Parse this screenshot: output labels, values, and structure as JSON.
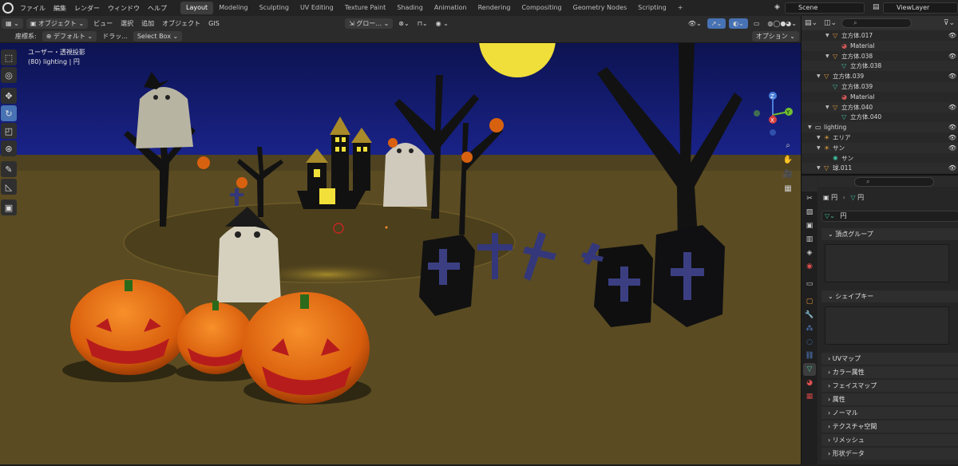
{
  "menus": [
    "ファイル",
    "編集",
    "レンダー",
    "ウィンドウ",
    "ヘルプ"
  ],
  "workspaces": [
    "Layout",
    "Modeling",
    "Sculpting",
    "UV Editing",
    "Texture Paint",
    "Shading",
    "Animation",
    "Rendering",
    "Compositing",
    "Geometry Nodes",
    "Scripting",
    "+"
  ],
  "scene": {
    "label": "Scene",
    "view_layer": "ViewLayer"
  },
  "header1": {
    "mode": "オブジェクト",
    "view": "ビュー",
    "select": "選択",
    "add": "追加",
    "object": "オブジェクト",
    "gis": "GIS",
    "transform": "グロー..."
  },
  "header2": {
    "coord_label": "座標系:",
    "coord_value": "デフォルト",
    "drag_label": "ドラッ...",
    "drag_value": "Select Box",
    "options": "オプション"
  },
  "viewport": {
    "view_name": "ユーザー・透視投影",
    "object_info": "(80) lighting | 円"
  },
  "gizmo": {
    "x": "X",
    "y": "Y",
    "z": "Z"
  },
  "outliner": {
    "rows": [
      {
        "label": "立方体.017",
        "indent": 3,
        "icon": "mesh",
        "color": "#e09a3c"
      },
      {
        "label": "Material",
        "indent": 4,
        "icon": "material",
        "color": "#c55"
      },
      {
        "label": "立方体.038",
        "indent": 3,
        "icon": "mesh",
        "color": "#e09a3c"
      },
      {
        "label": "立方体.038",
        "indent": 4,
        "icon": "meshdata",
        "color": "#3fbf9f"
      },
      {
        "label": "立方体.039",
        "indent": 2,
        "icon": "mesh",
        "color": "#e09a3c"
      },
      {
        "label": "立方体.039",
        "indent": 3,
        "icon": "meshdata",
        "color": "#3fbf9f"
      },
      {
        "label": "Material",
        "indent": 4,
        "icon": "material",
        "color": "#c55"
      },
      {
        "label": "立方体.040",
        "indent": 3,
        "icon": "mesh",
        "color": "#e09a3c"
      },
      {
        "label": "立方体.040",
        "indent": 4,
        "icon": "meshdata",
        "color": "#3fbf9f"
      },
      {
        "label": "lighting",
        "indent": 1,
        "icon": "collection",
        "color": "#ddd"
      },
      {
        "label": "エリア",
        "indent": 2,
        "icon": "light",
        "color": "#e0a03c"
      },
      {
        "label": "サン",
        "indent": 2,
        "icon": "light",
        "color": "#e0a03c"
      },
      {
        "label": "サン",
        "indent": 3,
        "icon": "lightdata",
        "color": "#3fbf9f"
      },
      {
        "label": "球.011",
        "indent": 2,
        "icon": "mesh",
        "color": "#e09a3c"
      }
    ]
  },
  "properties": {
    "breadcrumb_obj": "円",
    "breadcrumb_data": "円",
    "data_name": "円",
    "panels": [
      "頂点グループ",
      "シェイプキー",
      "UVマップ",
      "カラー属性",
      "フェイスマップ",
      "属性",
      "ノーマル",
      "テクスチャ空間",
      "リメッシュ",
      "形状データ"
    ]
  },
  "colors": {
    "active_tab": "#4772b3",
    "sky": "#12195e",
    "ground": "#5d4d24",
    "pumpkin": "#e36a14"
  }
}
